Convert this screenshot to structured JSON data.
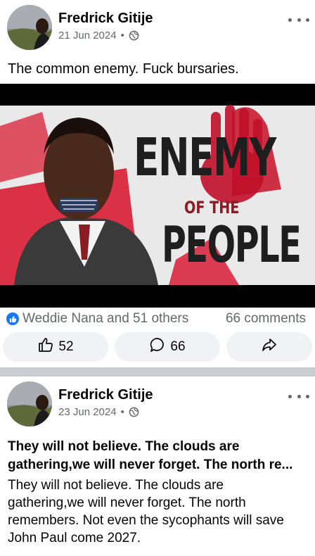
{
  "posts": [
    {
      "author": "Fredrick Gitije",
      "date": "21 Jun 2024",
      "separator": "•",
      "privacy_icon": "globe-icon",
      "caption": "The common enemy. Fuck bursaries.",
      "image_text": {
        "line1": "ENEMY",
        "line2": "OF THE",
        "line3": "PEOPLE"
      },
      "reactions_summary": "Weddie Nana and 51 others",
      "comments_summary": "66 comments",
      "like_count": "52",
      "comment_count": "66"
    },
    {
      "author": "Fredrick Gitije",
      "date": "23 Jun 2024",
      "separator": "•",
      "privacy_icon": "globe-icon",
      "title": "They will not believe. The clouds are gathering,we will never forget. The north re...",
      "body": "They will not believe. The clouds are gathering,we will never forget. The north remembers. Not even the sycophants will save John Paul come 2027."
    }
  ],
  "colors": {
    "accent": "#1877f2",
    "muted": "#65676b",
    "pill": "#f0f2f5",
    "divider": "#c9ccd1",
    "red": "#d8102a"
  }
}
